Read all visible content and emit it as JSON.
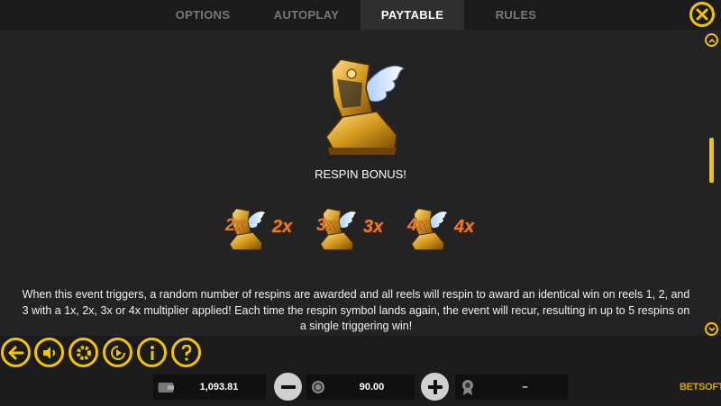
{
  "tabs": [
    {
      "label": "OPTIONS",
      "active": false
    },
    {
      "label": "AUTOPLAY",
      "active": false
    },
    {
      "label": "PAYTABLE",
      "active": true
    },
    {
      "label": "RULES",
      "active": false
    }
  ],
  "close_icon": "close-x-icon",
  "feature": {
    "title": "RESPIN BONUS!",
    "symbol_icon": "winged-boot-icon",
    "multipliers": [
      "2x",
      "3x",
      "4x"
    ],
    "description": "When this event triggers, a random number of respins are awarded and all reels will respin to award an identical win on reels 1, 2, and 3 with a 1x, 2x, 3x or 4x multiplier applied! Each time the respin symbol lands again, the event will recur, resulting in up to 5 respins on a single triggering win!"
  },
  "controls": [
    "back-arrow-icon",
    "speaker-icon",
    "gear-icon",
    "autoplay-icon",
    "info-icon",
    "help-icon"
  ],
  "status": {
    "balance": "1,093.81",
    "bet": "90.00",
    "win": "–",
    "balance_icon": "wallet-icon",
    "bet_icon": "coin-stack-icon",
    "win_icon": "medal-icon"
  },
  "brand": "BETSOFT",
  "colors": {
    "accent": "#f2c400",
    "multiplier": "#e8802a",
    "panel": "#232323",
    "background": "#1b1b1b"
  }
}
